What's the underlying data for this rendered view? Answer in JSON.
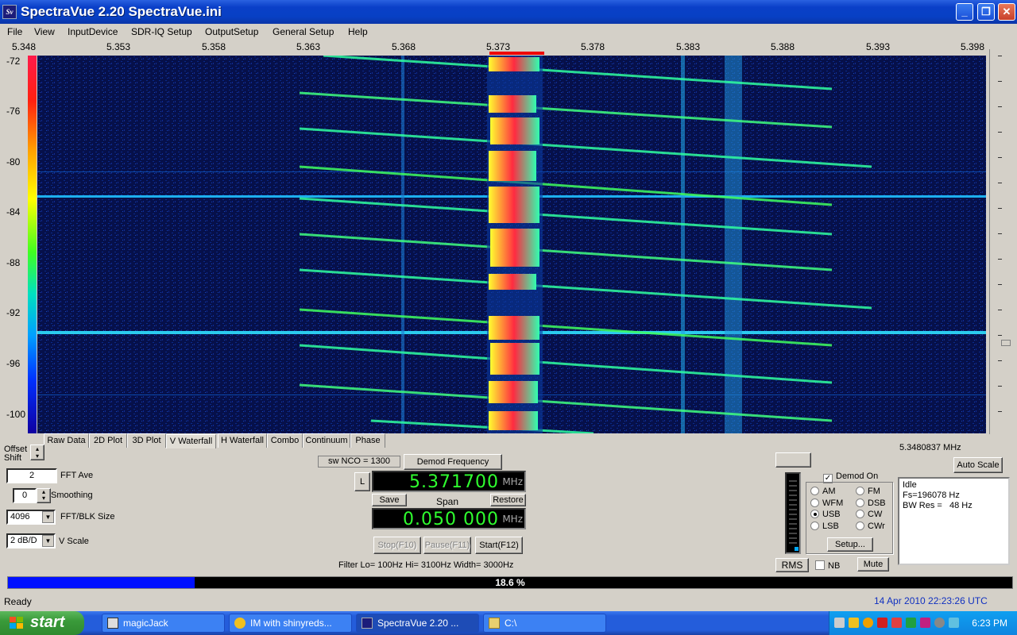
{
  "window": {
    "title": "SpectraVue 2.20  SpectraVue.ini",
    "app_icon": "Sv",
    "buttons": {
      "minimize": "_",
      "maximize": "❐",
      "close": "✕"
    }
  },
  "menu": [
    "File",
    "View",
    "InputDevice",
    "SDR-IQ Setup",
    "OutputSetup",
    "General Setup",
    "Help"
  ],
  "freq_axis": [
    "5.348",
    "5.353",
    "5.358",
    "5.363",
    "5.368",
    "5.373",
    "5.378",
    "5.383",
    "5.388",
    "5.393",
    "5.398"
  ],
  "db_axis": [
    "-72",
    "-76",
    "-80",
    "-84",
    "-88",
    "-92",
    "-96",
    "-100"
  ],
  "tabs": [
    "Raw Data",
    "2D Plot",
    "3D Plot",
    "V Waterfall",
    "H Waterfall",
    "Combo",
    "Continuum",
    "Phase"
  ],
  "active_tab": "V Waterfall",
  "left_controls": {
    "offset_label": "Offset",
    "shift_label": "Shift",
    "fft_ave_value": "2",
    "fft_ave_label": "FFT Ave",
    "smoothing_value": "0",
    "smoothing_label": "Smoothing",
    "fft_size_value": "4096",
    "fft_size_label": "FFT/BLK Size",
    "vscale_value": "2 dB/D",
    "vscale_label": "V Scale"
  },
  "center_controls": {
    "sw_nco": "sw NCO = 1300",
    "demod_freq_button": "Demod Frequency",
    "l_button": "L",
    "center_freq": "5.371700",
    "center_unit": "MHz",
    "save_button": "Save",
    "span_label": "Span",
    "restore_button": "Restore",
    "span_freq": "0.050 000",
    "span_unit": "MHz",
    "stop_button": "Stop(F10)",
    "pause_button": "Pause(F11)",
    "start_button": "Start(F12)",
    "filter_text": "Filter  Lo= 100Hz  Hi= 3100Hz  Width= 3000Hz"
  },
  "right_controls": {
    "cursor_freq": "5.3480837 MHz",
    "auto_scale_button": "Auto Scale",
    "demod_on_label": "Demod On",
    "demod_on_checked": true,
    "modes": [
      {
        "label": "AM",
        "selected": false
      },
      {
        "label": "FM",
        "selected": false
      },
      {
        "label": "WFM",
        "selected": false
      },
      {
        "label": "DSB",
        "selected": false
      },
      {
        "label": "USB",
        "selected": true
      },
      {
        "label": "CW",
        "selected": false
      },
      {
        "label": "LSB",
        "selected": false
      },
      {
        "label": "CWr",
        "selected": false
      }
    ],
    "setup_button": "Setup...",
    "rms_button": "RMS",
    "nb_label": "NB",
    "mute_button": "Mute",
    "info_lines": [
      "Idle",
      "Fs=196078 Hz",
      "BW Res =   48 Hz"
    ]
  },
  "progress": {
    "fraction": 0.186,
    "text": "18.6 %"
  },
  "status": {
    "left": "Ready",
    "right": "14 Apr 2010  22:23:26 UTC"
  },
  "taskbar": {
    "start_label": "start",
    "tasks": [
      {
        "label": "magicJack",
        "icon": "calculator-icon"
      },
      {
        "label": "IM with shinyreds...",
        "icon": "messenger-icon"
      },
      {
        "label": "SpectraVue 2.20  ...",
        "icon": "spectravue-icon"
      },
      {
        "label": "C:\\",
        "icon": "folder-icon"
      }
    ],
    "clock": "6:23 PM"
  },
  "colors": {
    "lcd_green": "#2fff2f",
    "titlebar_blue": "#0a3fc8",
    "progress_blue": "#0010ff",
    "waterfall_bg": "#050a38"
  }
}
